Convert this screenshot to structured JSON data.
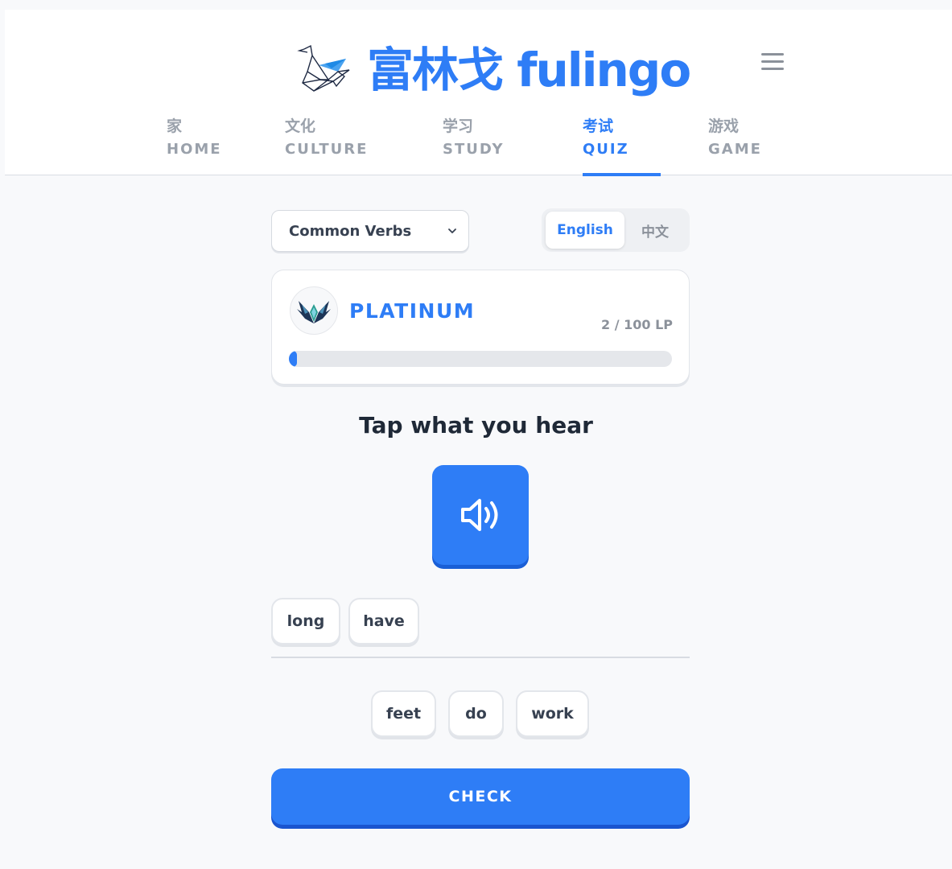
{
  "brand": {
    "chinese_name": "富林戈",
    "name": "fulingo",
    "accent_color": "#2e7df6"
  },
  "header": {
    "menu_icon": "hamburger-menu-icon"
  },
  "nav": {
    "items": [
      {
        "zh": "家",
        "en": "HOME"
      },
      {
        "zh": "文化",
        "en": "CULTURE"
      },
      {
        "zh": "学习",
        "en": "STUDY"
      },
      {
        "zh": "考试",
        "en": "QUIZ",
        "active": true
      },
      {
        "zh": "游戏",
        "en": "GAME"
      }
    ]
  },
  "category_select": {
    "selected": "Common Verbs"
  },
  "language_toggle": {
    "options": [
      "English",
      "中文"
    ],
    "selected": "English"
  },
  "rank": {
    "tier": "PLATINUM",
    "lp_text": "2 / 100 LP",
    "progress_fraction": 0.02,
    "emblem_icon": "winged-rank-emblem-icon"
  },
  "exercise": {
    "prompt": "Tap what you hear",
    "audio_icon": "speaker-volume-icon",
    "selected_words": [
      "long",
      "have"
    ],
    "word_bank": [
      "feet",
      "do",
      "work"
    ]
  },
  "actions": {
    "check_label": "CHECK"
  }
}
